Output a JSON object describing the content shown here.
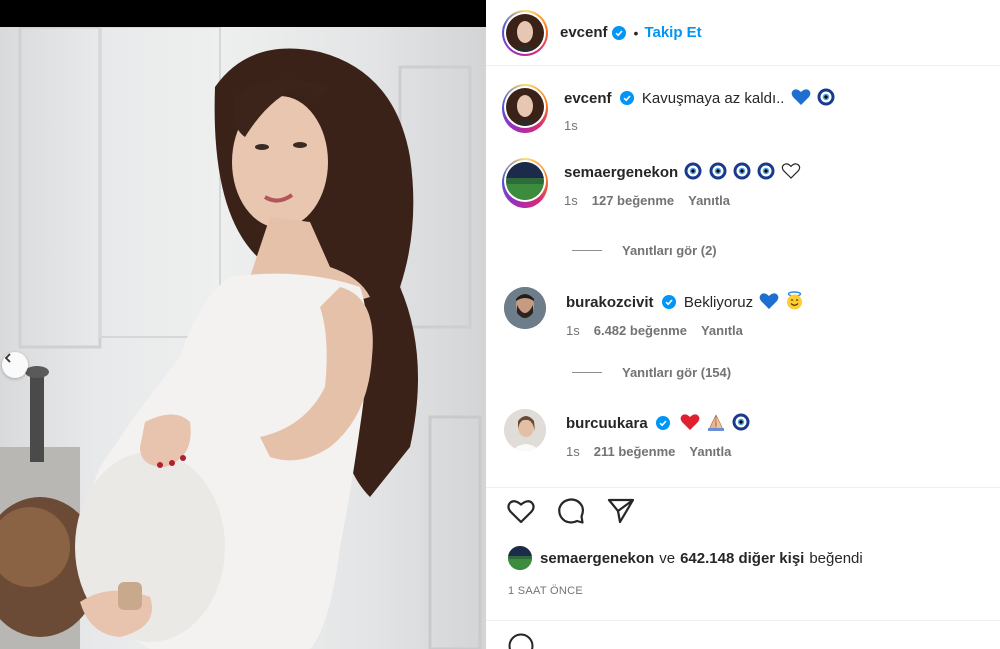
{
  "post": {
    "author": "evcenf",
    "follow_label": "Takip Et",
    "separator": "•",
    "caption": "Kavuşmaya az kaldı..",
    "caption_time": "1s"
  },
  "comments": [
    {
      "user": "semaergenekon",
      "verified": false,
      "text": "",
      "emoji": [
        "nazar-icon",
        "nazar-icon",
        "nazar-icon",
        "nazar-icon",
        "white-heart-icon"
      ],
      "time": "1s",
      "likes": "127 beğenme",
      "reply": "Yanıtla",
      "view_replies": "Yanıtları gör (2)"
    },
    {
      "user": "burakozcivit",
      "verified": true,
      "text": "Bekliyoruz",
      "emoji": [
        "blue-heart-icon",
        "smiling-halo-icon"
      ],
      "time": "1s",
      "likes": "6.482 beğenme",
      "reply": "Yanıtla",
      "view_replies": "Yanıtları gör (154)"
    },
    {
      "user": "burcuukara",
      "verified": true,
      "text": "",
      "emoji": [
        "red-heart-icon",
        "praying-hands-icon",
        "nazar-icon"
      ],
      "time": "1s",
      "likes": "211 beğenme",
      "reply": "Yanıtla"
    }
  ],
  "likes_line": {
    "user": "semaergenekon",
    "connector": "ve",
    "count": "642.148 diğer kişi",
    "suffix": "beğendi"
  },
  "post_time": "1 SAAT ÖNCE",
  "colors": {
    "accent": "#0095f6",
    "text": "#262626",
    "muted": "#737373",
    "border": "#efefef"
  }
}
